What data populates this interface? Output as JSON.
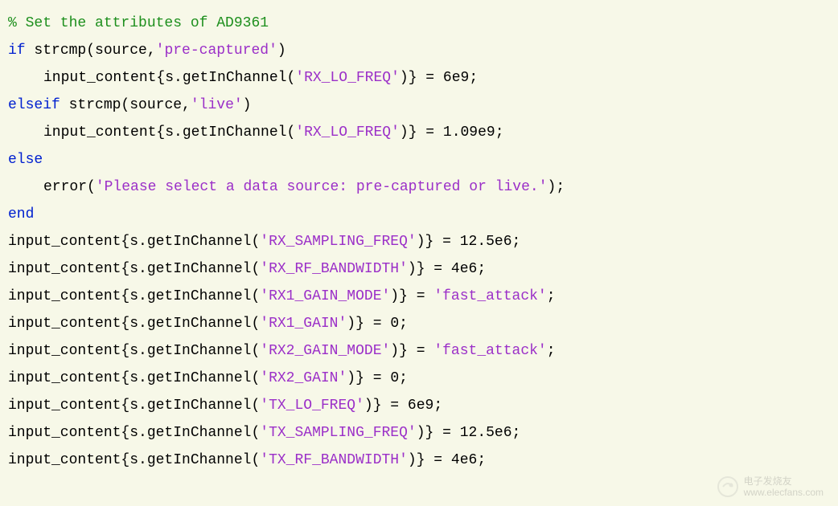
{
  "code": {
    "comment": "% Set the attributes of AD9361",
    "if": "if",
    "elseif": "elseif",
    "else": "else",
    "end": "end",
    "strcmp": "strcmp(source,",
    "precaptured": "'pre-captured'",
    "live": "'live'",
    "paren_close": ")",
    "input_content_open": "input_content{s.getInChannel(",
    "close_assign": ")} = ",
    "semicolon": ";",
    "error_fn": "error(",
    "error_msg": "'Please select a data source: pre-captured or live.'",
    "error_close": ");",
    "params": {
      "rx_lo_freq": "'RX_LO_FREQ'",
      "rx_sampling_freq": "'RX_SAMPLING_FREQ'",
      "rx_rf_bandwidth": "'RX_RF_BANDWIDTH'",
      "rx1_gain_mode": "'RX1_GAIN_MODE'",
      "rx1_gain": "'RX1_GAIN'",
      "rx2_gain_mode": "'RX2_GAIN_MODE'",
      "rx2_gain": "'RX2_GAIN'",
      "tx_lo_freq": "'TX_LO_FREQ'",
      "tx_sampling_freq": "'TX_SAMPLING_FREQ'",
      "tx_rf_bandwidth": "'TX_RF_BANDWIDTH'"
    },
    "values": {
      "six_e9": "6e9",
      "one09_e9": "1.09e9",
      "twelve5_e6": "12.5e6",
      "four_e6": "4e6",
      "zero": "0",
      "fast_attack": "'fast_attack'"
    }
  },
  "watermark": {
    "line1": "电子发烧友",
    "line2": "www.elecfans.com"
  }
}
